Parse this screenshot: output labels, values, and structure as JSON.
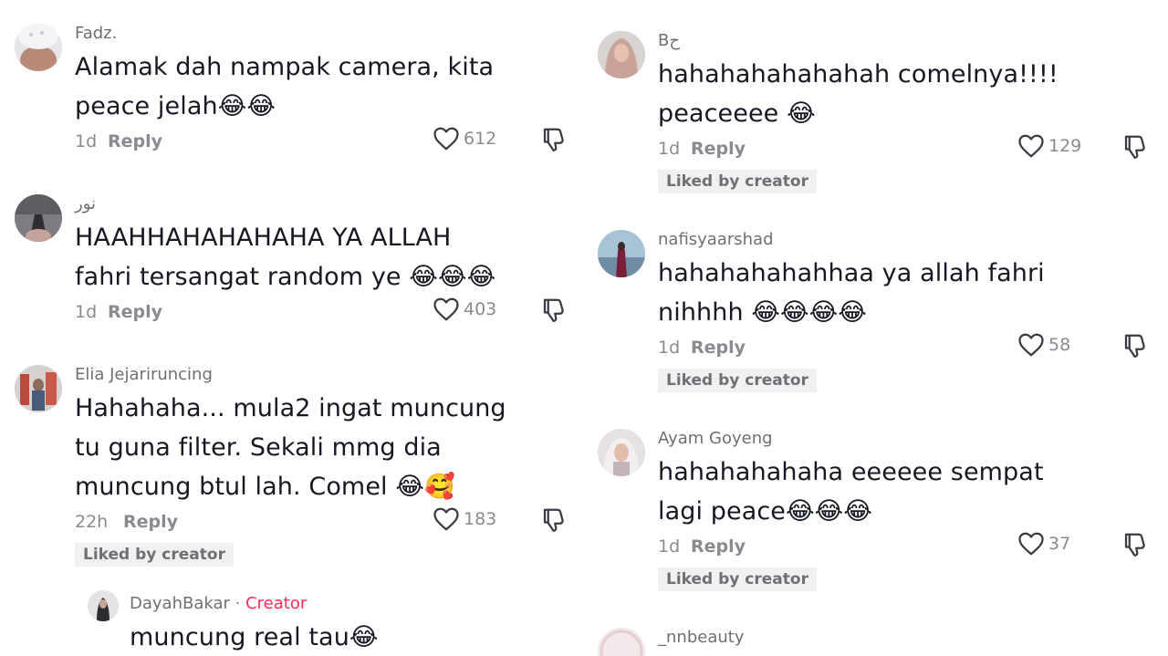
{
  "left_comments": [
    {
      "username": "Fadz.",
      "text_lines": [
        "Alamak dah nampak camera, kita",
        "peace jelah😂😂"
      ],
      "time": "1d",
      "reply_label": "Reply",
      "likes": "612",
      "liked_by_creator": ""
    },
    {
      "username": "نور",
      "text_lines": [
        "HAAHHAHAHAHAHA YA ALLAH",
        "fahri tersangat random ye 😂😂😂"
      ],
      "time": "1d",
      "reply_label": "Reply",
      "likes": "403",
      "liked_by_creator": ""
    },
    {
      "username": "Elia Jejariruncing",
      "text_lines": [
        "Hahahaha... mula2 ingat muncung",
        "tu guna filter. Sekali mmg dia",
        "muncung btul lah. Comel 😂🥰"
      ],
      "time": "22h",
      "reply_label": "Reply",
      "likes": "183",
      "liked_by_creator": "Liked by creator"
    }
  ],
  "creator_reply": {
    "username": "DayahBakar",
    "separator": "·",
    "creator_tag": "Creator",
    "text": "muncung real tau😂"
  },
  "right_comments": [
    {
      "username": "Bح",
      "text_lines": [
        "hahahahahahahah comelnya!!!!",
        "peaceeee 😂"
      ],
      "time": "1d",
      "reply_label": "Reply",
      "likes": "129",
      "liked_by_creator": "Liked by creator"
    },
    {
      "username": "nafisyaarshad",
      "text_lines": [
        "hahahahahahhaa ya allah fahri",
        "nihhhh 😂😂😂😂"
      ],
      "time": "1d",
      "reply_label": "Reply",
      "likes": "58",
      "liked_by_creator": "Liked by creator"
    },
    {
      "username": "Ayam Goyeng",
      "text_lines": [
        "hahahahahaha eeeeee sempat",
        "lagi peace😂😂😂"
      ],
      "time": "1d",
      "reply_label": "Reply",
      "likes": "37",
      "liked_by_creator": "Liked by creator"
    },
    {
      "username": "_nnbeauty",
      "text_lines": [],
      "time": "",
      "reply_label": "",
      "likes": "",
      "liked_by_creator": ""
    }
  ],
  "colors": {
    "text": "#161823",
    "secondary": "#8a8b91",
    "creator_accent": "#fe2c55",
    "badge_bg": "#f1f1f2"
  },
  "icons": {
    "like": "heart-outline-icon",
    "dislike": "thumbs-down-icon"
  }
}
